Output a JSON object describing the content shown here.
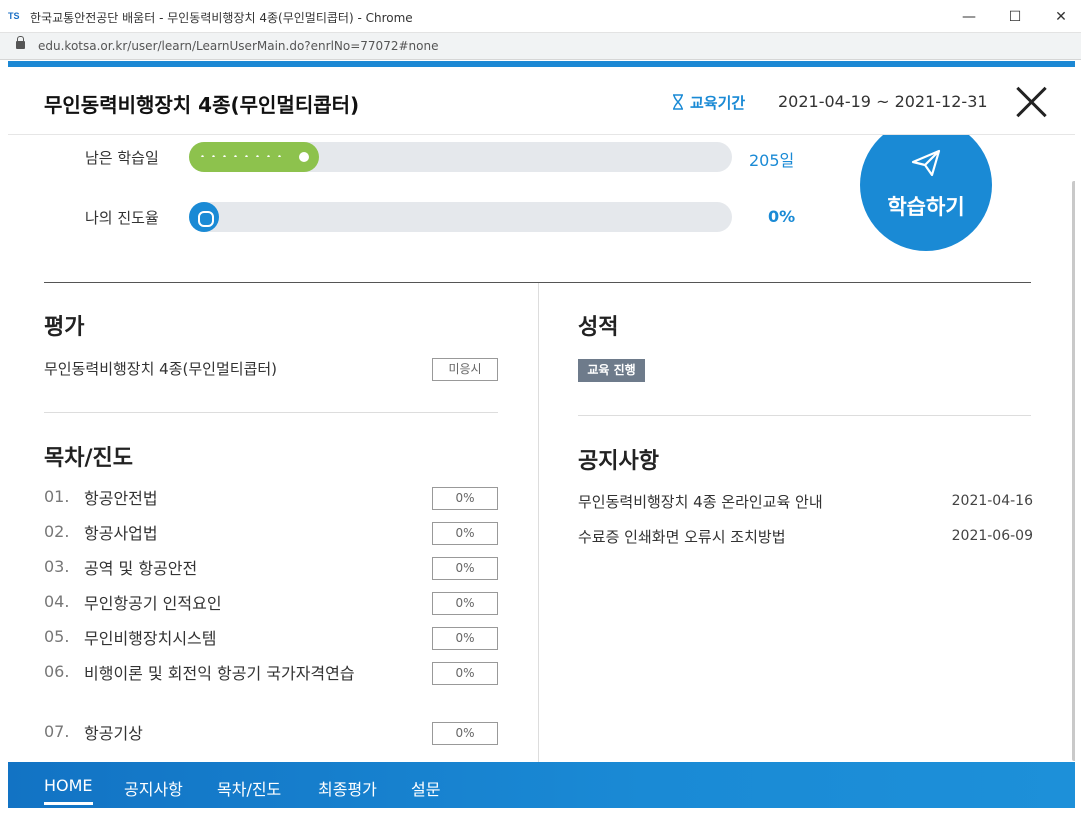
{
  "window": {
    "favicon": "TS",
    "title": "한국교통안전공단 배움터 - 무인동력비행장치 4종(무인멀티콥터) - Chrome",
    "minimize": "—",
    "maximize": "☐",
    "close": "✕",
    "url": "edu.kotsa.or.kr/user/learn/LearnUserMain.do?enrlNo=77072#none"
  },
  "header": {
    "course_title": "무인동력비행장치 4종(무인멀티콥터)",
    "period_icon": "hourglass-icon",
    "period_label": "교육기간",
    "period_dates": "2021-04-19 ~ 2021-12-31"
  },
  "progress": {
    "remaining_label": "남은 학습일",
    "remaining_value": "205일",
    "remaining_fraction": 0.24,
    "my_progress_label": "나의 진도율",
    "my_progress_value": "0%",
    "my_progress_fraction": 0
  },
  "start_button": {
    "icon": "paper-plane-icon",
    "label": "학습하기"
  },
  "evaluation": {
    "title": "평가",
    "item_name": "무인동력비행장치 4종(무인멀티콥터)",
    "item_status": "미응시"
  },
  "grade": {
    "title": "성적",
    "badge": "교육 진행"
  },
  "toc": {
    "title": "목차/진도",
    "items": [
      {
        "num": "01.",
        "label": "항공안전법",
        "pct": "0%"
      },
      {
        "num": "02.",
        "label": "항공사업법",
        "pct": "0%"
      },
      {
        "num": "03.",
        "label": "공역 및 항공안전",
        "pct": "0%"
      },
      {
        "num": "04.",
        "label": "무인항공기 인적요인",
        "pct": "0%"
      },
      {
        "num": "05.",
        "label": "무인비행장치시스템",
        "pct": "0%"
      },
      {
        "num": "06.",
        "label": "비행이론 및 회전익 항공기 국가자격연습",
        "pct": "0%"
      },
      {
        "num": "07.",
        "label": "항공기상",
        "pct": "0%"
      }
    ]
  },
  "notices": {
    "title": "공지사항",
    "items": [
      {
        "title": "무인동력비행장치 4종 온라인교육 안내",
        "date": "2021-04-16"
      },
      {
        "title": "수료증 인쇄화면 오류시 조치방법",
        "date": "2021-06-09"
      }
    ]
  },
  "bottom_nav": {
    "items": [
      "HOME",
      "공지사항",
      "목차/진도",
      "최종평가",
      "설문"
    ],
    "active": "HOME"
  }
}
